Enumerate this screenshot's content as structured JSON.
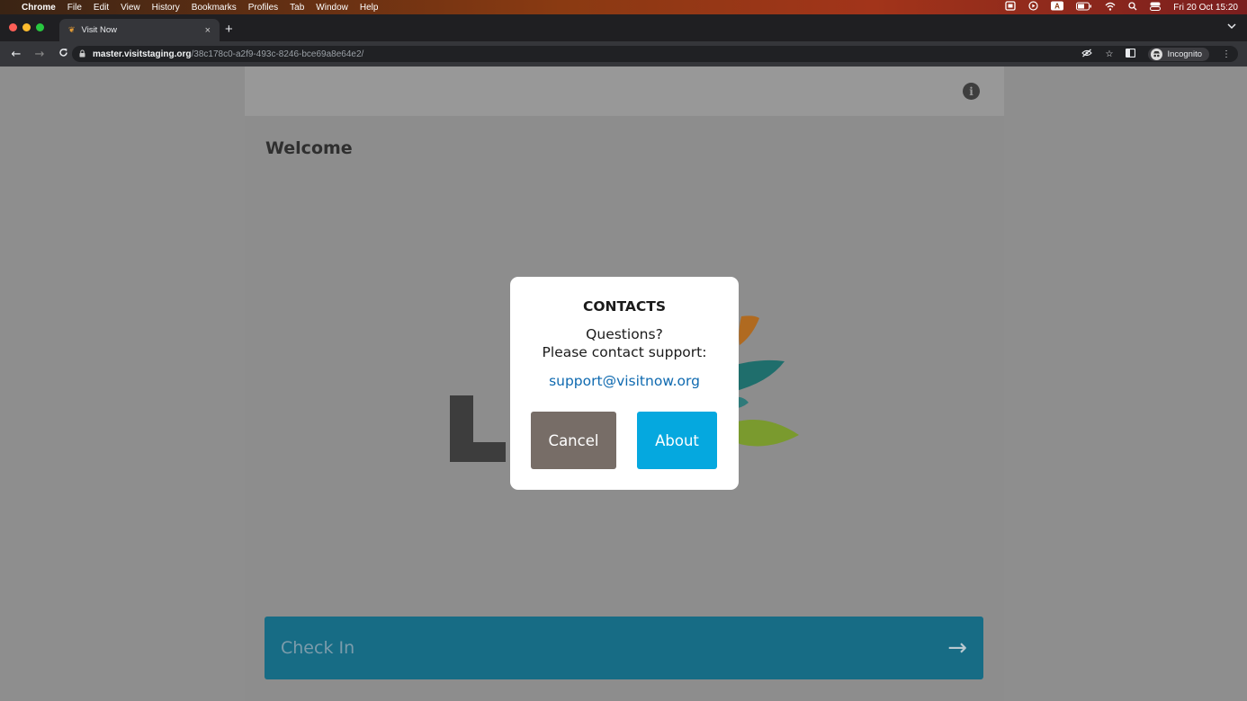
{
  "menubar": {
    "apple_icon": "apple-icon",
    "app_name": "Chrome",
    "items": [
      "File",
      "Edit",
      "View",
      "History",
      "Bookmarks",
      "Profiles",
      "Tab",
      "Window",
      "Help"
    ],
    "datetime": "Fri 20 Oct  15:20"
  },
  "browser": {
    "tab_title": "Visit Now",
    "new_tab_symbol": "+",
    "close_symbol": "×",
    "url_host": "master.visitstaging.org",
    "url_path": "/38c178c0-a2f9-493c-8246-bce69a8e64e2/",
    "profile_label": "Incognito"
  },
  "page": {
    "welcome": "Welcome",
    "check_in_label": "Check In",
    "check_in_arrow": "→"
  },
  "modal": {
    "title": "CONTACTS",
    "line1": "Questions?",
    "line2": "Please contact support:",
    "email": "support@visitnow.org",
    "cancel_label": "Cancel",
    "about_label": "About"
  },
  "colors": {
    "check_in_bg": "#176c85",
    "cancel_bg": "#776d67",
    "about_bg": "#05a8df",
    "email_link": "#0f6ab0"
  }
}
